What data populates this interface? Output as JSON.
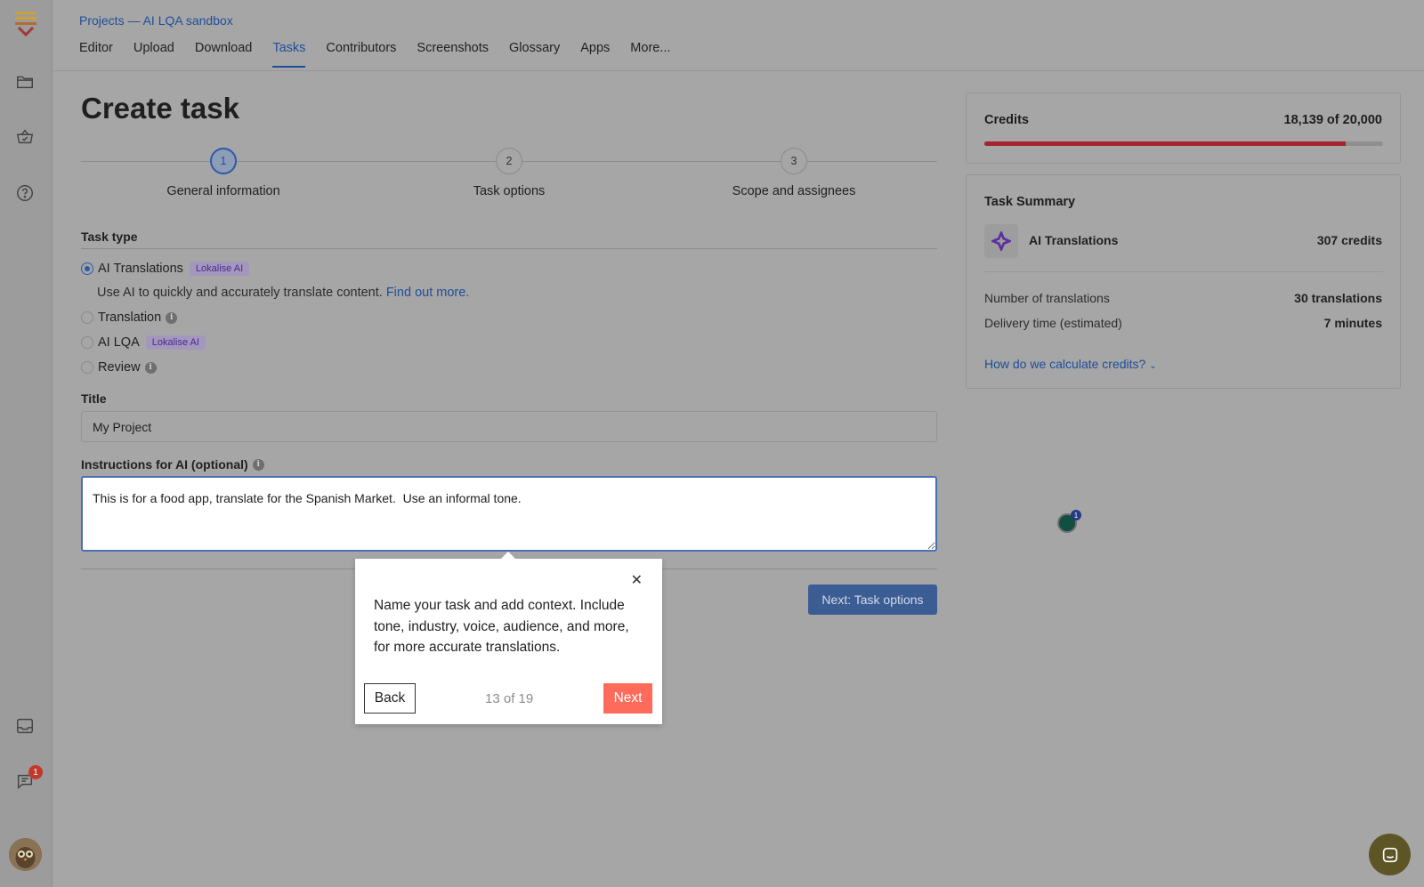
{
  "breadcrumb": {
    "root": "Projects",
    "separator": "—",
    "project": "AI LQA sandbox"
  },
  "tabs": [
    "Editor",
    "Upload",
    "Download",
    "Tasks",
    "Contributors",
    "Screenshots",
    "Glossary",
    "Apps",
    "More..."
  ],
  "active_tab": "Tasks",
  "page": {
    "title": "Create task"
  },
  "steps": [
    {
      "number": "1",
      "label": "General information",
      "active": true
    },
    {
      "number": "2",
      "label": "Task options",
      "active": false
    },
    {
      "number": "3",
      "label": "Scope and assignees",
      "active": false
    }
  ],
  "task_type": {
    "label": "Task type",
    "options": [
      {
        "label": "AI Translations",
        "badge": "Lokalise AI",
        "checked": true
      },
      {
        "label": "Translation",
        "info": true
      },
      {
        "label": "AI LQA",
        "badge": "Lokalise AI"
      },
      {
        "label": "Review",
        "info": true
      }
    ],
    "description": "Use AI to quickly and accurately translate content.",
    "description_link": "Find out more."
  },
  "title_field": {
    "label": "Title",
    "value": "My Project"
  },
  "instructions": {
    "label": "Instructions for AI (optional)",
    "value": "This is for a food app, translate for the Spanish Market.  Use an informal tone."
  },
  "next_button": "Next: Task options",
  "credits": {
    "title": "Credits",
    "value": "18,139 of 20,000",
    "used_fraction": 0.907
  },
  "summary": {
    "title": "Task Summary",
    "item": "AI Translations",
    "item_credits": "307 credits",
    "rows": [
      {
        "label": "Number of translations",
        "value": "30 translations"
      },
      {
        "label": "Delivery time (estimated)",
        "value": "7 minutes"
      }
    ],
    "link": "How do we calculate credits?"
  },
  "marker_badge": "1",
  "sidebar_badge": "1",
  "popover": {
    "text": "Name your task and add context. Include tone, industry, voice, audience, and more, for more accurate translations.",
    "back": "Back",
    "counter": "13 of 19",
    "next": "Next"
  },
  "colors": {
    "accent": "#1e4e9a",
    "primary_button": "#3c5d94",
    "tour_next": "#ff6b5b",
    "credits_bar": "#a3232e",
    "ai_badge": "#a497bd"
  }
}
